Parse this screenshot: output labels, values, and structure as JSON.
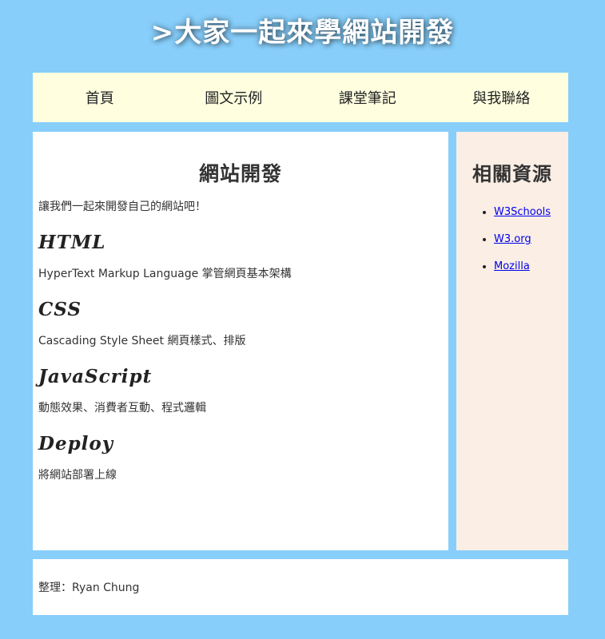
{
  "header": {
    "title": ">大家一起來學網站開發"
  },
  "nav": {
    "items": [
      {
        "label": "首頁"
      },
      {
        "label": "圖文示例"
      },
      {
        "label": "課堂筆記"
      },
      {
        "label": "與我聯絡"
      }
    ]
  },
  "main": {
    "title": "網站開發",
    "intro": "讓我們一起來開發自己的網站吧！",
    "sections": [
      {
        "title": "HTML",
        "desc": "HyperText Markup Language 掌管網頁基本架構"
      },
      {
        "title": "CSS",
        "desc": "Cascading Style Sheet 網頁樣式、排版"
      },
      {
        "title": "JavaScript",
        "desc": "動態效果、消費者互動、程式邏輯"
      },
      {
        "title": "Deploy",
        "desc": "將網站部署上線"
      }
    ]
  },
  "sidebar": {
    "title": "相關資源",
    "links": [
      {
        "label": "W3Schools"
      },
      {
        "label": "W3.org"
      },
      {
        "label": "Mozilla"
      }
    ]
  },
  "footer": {
    "text": "整理：Ryan Chung"
  },
  "colors": {
    "page_background": "#87CEFA",
    "nav_background": "#FFFFE0",
    "sidebar_background": "#FAEEE5",
    "content_background": "#FFFFFF",
    "link": "#0000EE"
  }
}
